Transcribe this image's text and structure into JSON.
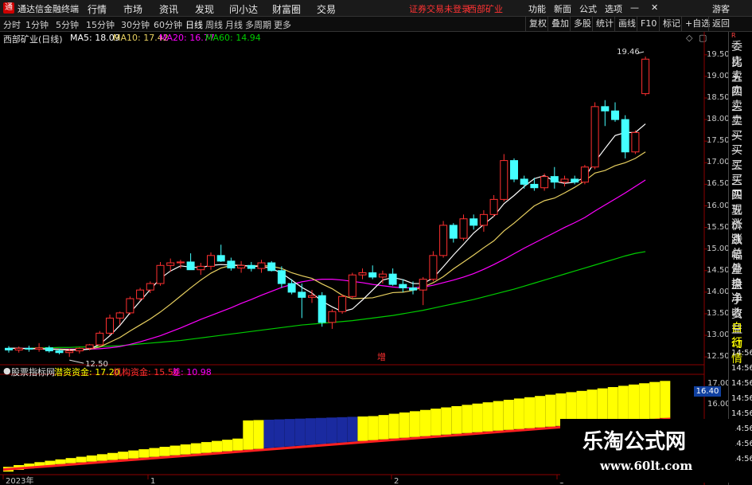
{
  "menu": {
    "app_title": "通达信金融终端",
    "items": [
      "行情",
      "市场",
      "资讯",
      "发现",
      "问小达",
      "财富圈",
      "交易"
    ],
    "notice": "证券交易未登录",
    "stock_name": "西部矿业",
    "right_items": [
      "功能",
      "新面",
      "公式",
      "选项"
    ],
    "guest": "游客"
  },
  "tabs": {
    "periods": [
      "分时",
      "1分钟",
      "5分钟",
      "15分钟",
      "30分钟",
      "60分钟",
      "日线",
      "周线",
      "月线",
      "多周期",
      "更多"
    ],
    "active": "日线",
    "right_buttons": [
      "复权",
      "叠加",
      "多股",
      "统计",
      "画线",
      "F10",
      "标记",
      "+自选",
      "返回"
    ]
  },
  "info": {
    "title": "西部矿业(日线)",
    "ma5": "MA5: 18.09",
    "ma10": "MA10: 17.42",
    "ma20": "MA20: 16.77",
    "ma60": "MA60: 14.94"
  },
  "price_axis": [
    "19.50",
    "19.00",
    "18.50",
    "18.00",
    "17.50",
    "17.00",
    "16.50",
    "16.00",
    "15.50",
    "15.00",
    "14.50",
    "14.00",
    "13.50",
    "13.00",
    "12.50"
  ],
  "annotations": {
    "high": "19.46",
    "low": "12.50",
    "mid_label": "增"
  },
  "indicator": {
    "name": "股票指标网",
    "a": "潜资资金: 17.20",
    "b": "机构资金: 15.50",
    "c": "差: 10.98",
    "value_box": "16.40",
    "axis": [
      "17.00",
      "16.00"
    ]
  },
  "time_axis": [
    "2023年",
    "1",
    "2",
    "3"
  ],
  "right_panel": {
    "labels": [
      "委比",
      "卖五",
      "卖四",
      "卖三",
      "卖二",
      "卖一",
      "买一",
      "买二",
      "买三",
      "买四",
      "买五",
      "现价",
      "涨跌",
      "涨幅",
      "总量",
      "外盘",
      "换手",
      "净资",
      "收益",
      "自动",
      "行情"
    ],
    "times": [
      "14:56",
      "14:56",
      "14:56",
      "14:56",
      "14:56",
      "14:56",
      "14:56",
      "14:56"
    ]
  },
  "watermark": {
    "title": "乐淘公式网",
    "url": "www.60lt.com"
  },
  "colors": {
    "up": "#ff3030",
    "down": "#44ffff",
    "ma5": "#ffffff",
    "ma10": "#e8d060",
    "ma20": "#ff00ff",
    "ma60": "#00cc00"
  },
  "chart_data": {
    "type": "candlestick",
    "ylim": [
      12.3,
      19.7
    ],
    "candles": [
      [
        12.7,
        12.75,
        12.6,
        12.66
      ],
      [
        12.66,
        12.74,
        12.6,
        12.7
      ],
      [
        12.7,
        12.76,
        12.62,
        12.68
      ],
      [
        12.68,
        12.82,
        12.62,
        12.71
      ],
      [
        12.71,
        12.76,
        12.6,
        12.64
      ],
      [
        12.64,
        12.69,
        12.56,
        12.6
      ],
      [
        12.6,
        12.68,
        12.5,
        12.64
      ],
      [
        12.64,
        12.72,
        12.58,
        12.7
      ],
      [
        12.7,
        12.8,
        12.65,
        12.78
      ],
      [
        12.78,
        13.1,
        12.76,
        13.05
      ],
      [
        13.05,
        13.48,
        13.0,
        13.4
      ],
      [
        13.4,
        13.55,
        13.25,
        13.52
      ],
      [
        13.52,
        13.9,
        13.48,
        13.85
      ],
      [
        13.85,
        14.1,
        13.8,
        14.05
      ],
      [
        14.05,
        14.25,
        13.98,
        14.2
      ],
      [
        14.2,
        14.7,
        14.15,
        14.62
      ],
      [
        14.62,
        14.78,
        14.48,
        14.68
      ],
      [
        14.68,
        14.75,
        14.55,
        14.7
      ],
      [
        14.7,
        14.9,
        14.55,
        14.52
      ],
      [
        14.52,
        14.68,
        14.4,
        14.6
      ],
      [
        14.6,
        14.92,
        14.52,
        14.85
      ],
      [
        14.85,
        15.1,
        14.7,
        14.72
      ],
      [
        14.72,
        14.8,
        14.5,
        14.56
      ],
      [
        14.56,
        14.72,
        14.45,
        14.62
      ],
      [
        14.62,
        14.7,
        14.48,
        14.55
      ],
      [
        14.55,
        14.75,
        14.45,
        14.68
      ],
      [
        14.68,
        14.72,
        14.48,
        14.5
      ],
      [
        14.5,
        14.6,
        14.1,
        14.2
      ],
      [
        14.2,
        14.3,
        13.95,
        14.0
      ],
      [
        14.0,
        14.2,
        13.4,
        13.88
      ],
      [
        13.88,
        14.05,
        13.75,
        13.92
      ],
      [
        13.92,
        14.0,
        13.2,
        13.3
      ],
      [
        13.3,
        13.6,
        13.15,
        13.55
      ],
      [
        13.55,
        13.95,
        13.5,
        13.9
      ],
      [
        13.9,
        14.45,
        13.85,
        14.4
      ],
      [
        14.4,
        14.55,
        14.3,
        14.45
      ],
      [
        14.45,
        14.62,
        14.3,
        14.35
      ],
      [
        14.35,
        14.5,
        14.2,
        14.42
      ],
      [
        14.42,
        14.55,
        14.15,
        14.18
      ],
      [
        14.18,
        14.3,
        14.0,
        14.1
      ],
      [
        14.1,
        14.25,
        13.95,
        14.05
      ],
      [
        14.05,
        14.35,
        13.7,
        14.3
      ],
      [
        14.3,
        14.95,
        14.25,
        14.85
      ],
      [
        14.85,
        15.65,
        14.8,
        15.55
      ],
      [
        15.55,
        15.6,
        15.15,
        15.25
      ],
      [
        15.25,
        15.8,
        15.2,
        15.7
      ],
      [
        15.7,
        15.8,
        15.45,
        15.55
      ],
      [
        15.55,
        15.9,
        15.4,
        15.8
      ],
      [
        15.8,
        16.25,
        15.75,
        16.15
      ],
      [
        16.15,
        17.2,
        16.1,
        17.05
      ],
      [
        17.05,
        17.1,
        16.55,
        16.62
      ],
      [
        16.62,
        16.7,
        16.4,
        16.5
      ],
      [
        16.5,
        16.65,
        16.35,
        16.42
      ],
      [
        16.42,
        16.75,
        16.35,
        16.68
      ],
      [
        16.68,
        16.9,
        16.4,
        16.55
      ],
      [
        16.55,
        16.7,
        16.45,
        16.62
      ],
      [
        16.62,
        16.7,
        16.5,
        16.55
      ],
      [
        16.55,
        16.95,
        16.5,
        16.9
      ],
      [
        16.9,
        18.4,
        16.85,
        18.3
      ],
      [
        18.3,
        18.45,
        17.85,
        18.2
      ],
      [
        18.2,
        18.4,
        17.95,
        18.0
      ],
      [
        18.0,
        18.1,
        17.1,
        17.25
      ],
      [
        17.25,
        17.75,
        17.2,
        17.7
      ],
      [
        18.6,
        19.46,
        18.55,
        19.4
      ]
    ],
    "ma5": [
      12.7,
      12.7,
      12.69,
      12.69,
      12.68,
      12.67,
      12.66,
      12.66,
      12.68,
      12.79,
      12.99,
      13.23,
      13.52,
      13.79,
      14.06,
      14.32,
      14.49,
      14.61,
      14.58,
      14.57,
      14.62,
      14.64,
      14.63,
      14.62,
      14.6,
      14.6,
      14.55,
      14.44,
      14.28,
      14.11,
      13.98,
      13.79,
      13.66,
      13.55,
      13.61,
      13.82,
      14.05,
      14.28,
      14.34,
      14.29,
      14.2,
      14.2,
      14.33,
      14.59,
      14.86,
      15.11,
      15.37,
      15.57,
      15.76,
      16.05,
      16.24,
      16.45,
      16.63,
      16.7,
      16.57,
      16.52,
      16.55,
      16.66,
      17.02,
      17.33,
      17.63,
      17.7,
      17.7,
      17.9
    ],
    "ma10": [
      12.7,
      12.7,
      12.69,
      12.69,
      12.68,
      12.68,
      12.67,
      12.67,
      12.68,
      12.73,
      12.84,
      12.95,
      13.1,
      13.24,
      13.38,
      13.54,
      13.72,
      13.91,
      14.1,
      14.28,
      14.44,
      14.56,
      14.62,
      14.62,
      14.6,
      14.62,
      14.6,
      14.55,
      14.45,
      14.38,
      14.32,
      14.19,
      14.08,
      13.93,
      13.85,
      13.86,
      13.87,
      13.93,
      13.99,
      14.0,
      14.04,
      14.12,
      14.22,
      14.36,
      14.54,
      14.7,
      14.86,
      15.03,
      15.19,
      15.42,
      15.6,
      15.8,
      16.0,
      16.12,
      16.18,
      16.3,
      16.43,
      16.58,
      16.76,
      16.82,
      16.93,
      17.0,
      17.1,
      17.25
    ],
    "ma20": [
      12.7,
      12.7,
      12.7,
      12.69,
      12.69,
      12.68,
      12.68,
      12.68,
      12.68,
      12.69,
      12.71,
      12.74,
      12.79,
      12.85,
      12.92,
      12.99,
      13.08,
      13.17,
      13.27,
      13.37,
      13.46,
      13.55,
      13.64,
      13.74,
      13.83,
      13.93,
      14.02,
      14.11,
      14.18,
      14.24,
      14.28,
      14.3,
      14.3,
      14.28,
      14.25,
      14.22,
      14.18,
      14.15,
      14.12,
      14.1,
      14.1,
      14.12,
      14.16,
      14.22,
      14.28,
      14.35,
      14.43,
      14.53,
      14.64,
      14.76,
      14.89,
      15.02,
      15.14,
      15.26,
      15.38,
      15.5,
      15.61,
      15.73,
      15.88,
      16.02,
      16.16,
      16.3,
      16.45,
      16.6
    ],
    "ma60": [
      12.7,
      12.7,
      12.7,
      12.71,
      12.71,
      12.72,
      12.72,
      12.73,
      12.73,
      12.74,
      12.75,
      12.76,
      12.78,
      12.8,
      12.82,
      12.84,
      12.86,
      12.88,
      12.91,
      12.94,
      12.97,
      13.0,
      13.03,
      13.06,
      13.09,
      13.12,
      13.15,
      13.18,
      13.21,
      13.24,
      13.26,
      13.28,
      13.3,
      13.32,
      13.34,
      13.37,
      13.4,
      13.43,
      13.46,
      13.5,
      13.54,
      13.58,
      13.63,
      13.68,
      13.73,
      13.78,
      13.83,
      13.89,
      13.95,
      14.01,
      14.07,
      14.14,
      14.21,
      14.28,
      14.35,
      14.42,
      14.49,
      14.56,
      14.63,
      14.7,
      14.77,
      14.84,
      14.9,
      14.94
    ]
  }
}
